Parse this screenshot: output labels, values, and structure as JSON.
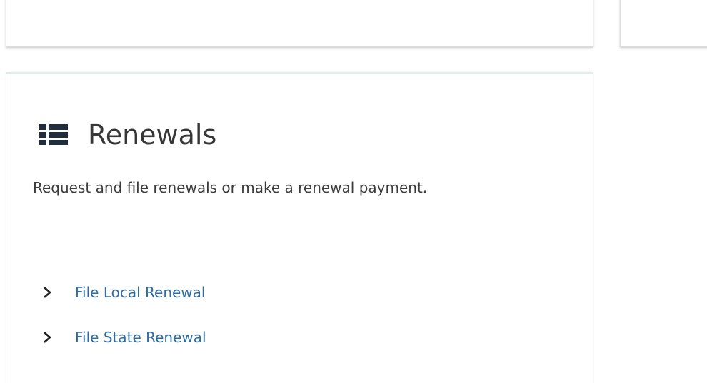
{
  "renewals_card": {
    "icon": "list-icon",
    "title": "Renewals",
    "description": "Request and file renewals or make a renewal payment.",
    "links": [
      {
        "label": "File Local Renewal",
        "icon": "chevron-right-icon"
      },
      {
        "label": "File State Renewal",
        "icon": "chevron-right-icon"
      }
    ]
  },
  "colors": {
    "link": "#2e6da4",
    "title": "#373737",
    "text": "#3c3c3c",
    "icon": "#1f2d3d",
    "card_border": "#dcdcdc"
  }
}
